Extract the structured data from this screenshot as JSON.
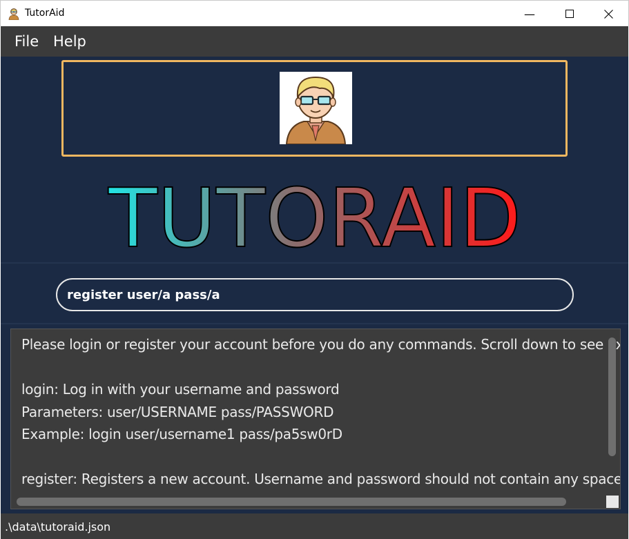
{
  "window": {
    "title": "TutorAid",
    "min_glyph": "—",
    "max_glyph": "☐",
    "close_glyph": "✕"
  },
  "menu": {
    "items": [
      {
        "label": "File"
      },
      {
        "label": "Help"
      }
    ]
  },
  "logo": {
    "text": "TUTORAID",
    "gradient_start": "#22e3e3",
    "gradient_mid": "#8a6d6d",
    "gradient_end": "#ff1a1a"
  },
  "command": {
    "value": "register user/a pass/a"
  },
  "result": {
    "lines": [
      "Please login or register your account before you do any commands. Scroll down to see examples",
      "",
      "login: Log in with your username and password",
      "Parameters: user/USERNAME pass/PASSWORD",
      "Example: login user/username1 pass/pa5sw0rD",
      "",
      "register: Registers a new account. Username and password should not contain any spaces"
    ]
  },
  "status": {
    "path": ".\\data\\tutoraid.json"
  },
  "colors": {
    "background": "#1b2a44",
    "banner_border": "#f0b760",
    "bar": "#3b3b3b"
  }
}
